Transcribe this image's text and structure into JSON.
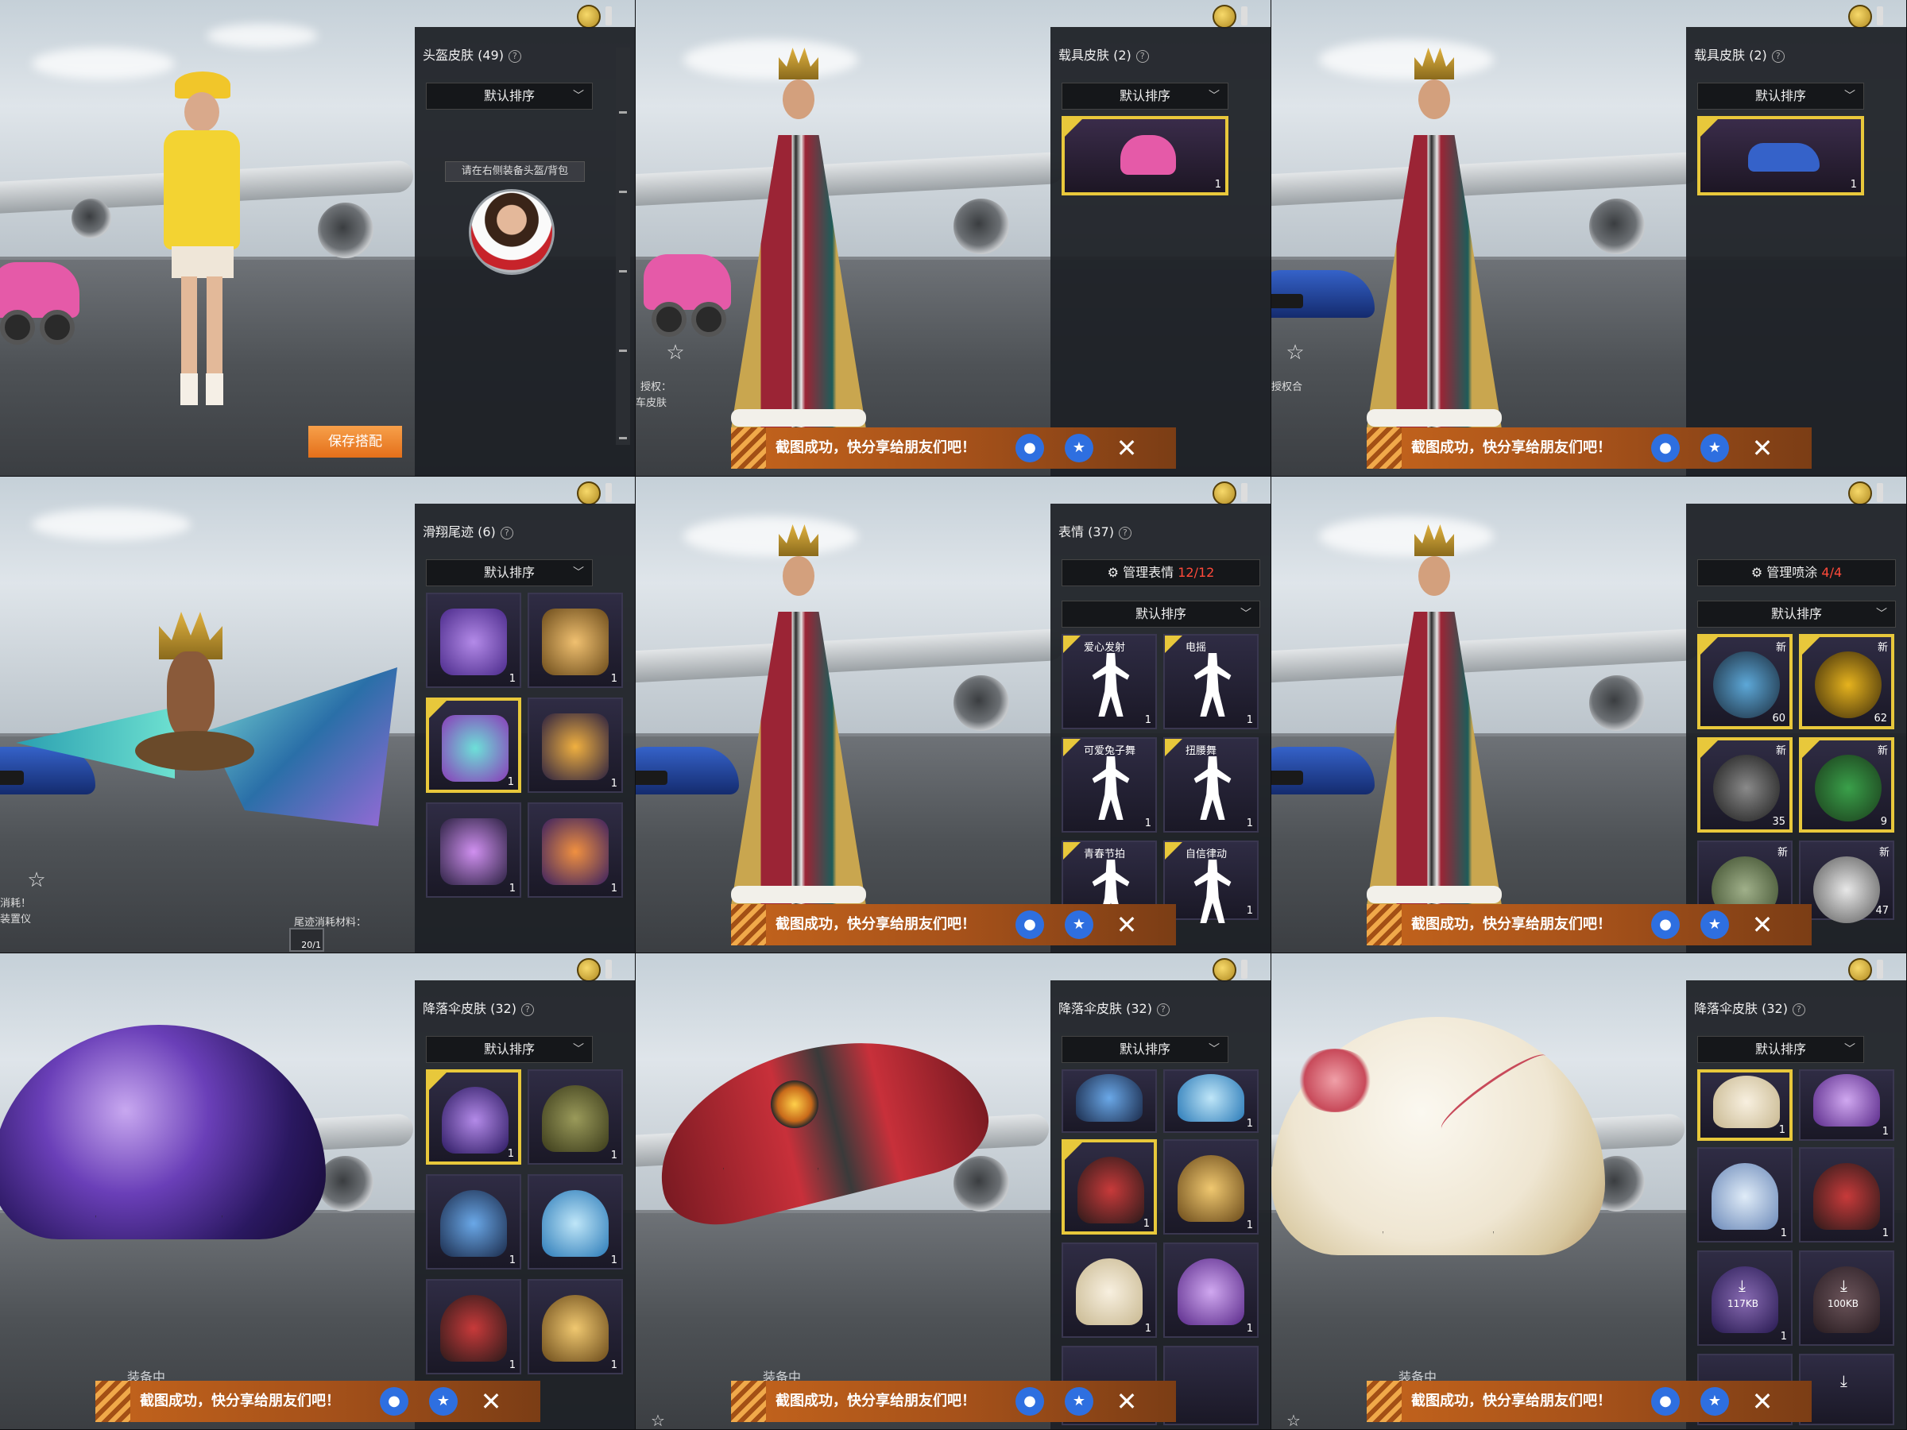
{
  "panels": [
    {
      "title": "头盔皮肤 (49)",
      "sort": "默认排序"
    },
    {
      "title": "载具皮肤 (2)",
      "sort": "默认排序"
    },
    {
      "title": "载具皮肤 (2)",
      "sort": "默认排序"
    },
    {
      "title": "滑翔尾迹 (6)",
      "sort": "默认排序"
    },
    {
      "title": "表情 (37)",
      "sort": "默认排序",
      "manage": "管理表情",
      "manage_count": "12/12"
    },
    {
      "title": "",
      "sort": "默认排序",
      "manage": "管理喷涂",
      "manage_count": "4/4"
    },
    {
      "title": "降落伞皮肤 (32)",
      "sort": "默认排序"
    },
    {
      "title": "降落伞皮肤 (32)",
      "sort": "默认排序"
    },
    {
      "title": "降落伞皮肤 (32)",
      "sort": "默认排序"
    }
  ],
  "help_icon": "question-circle-icon",
  "tooltip": "请在右侧装备头盔/背包",
  "save_button": "保存搭配",
  "share_bar": {
    "text": "截图成功，快分享给朋友们吧！",
    "qq_icon": "qq-penguin-icon",
    "qzone_icon": "qzone-star-icon",
    "close_icon": "close-x-icon"
  },
  "left_texts": {
    "license_1": "授权：",
    "license_2": "车皮肤",
    "license_3": "授权合",
    "trail_side_1": "消耗！",
    "trail_side_2": "装置仪",
    "trail_material": "尾迹消耗材料：",
    "trail_material_count": "20/1",
    "equipped": "装备中"
  },
  "trail_tiles": [
    {
      "count": "1",
      "selected": false,
      "color": "#7a55c9"
    },
    {
      "count": "1",
      "selected": false,
      "color": "#b07a2a"
    },
    {
      "count": "1",
      "selected": true,
      "color": "#3bb0b8"
    },
    {
      "count": "1",
      "selected": false,
      "color": "#d89a2a"
    },
    {
      "count": "1",
      "selected": false,
      "color": "#b35de0"
    },
    {
      "count": "1",
      "selected": false,
      "color": "#e06a2a"
    }
  ],
  "emote_tiles": [
    {
      "name": "爱心发射",
      "count": "1",
      "selected": true
    },
    {
      "name": "电摇",
      "count": "1",
      "selected": true
    },
    {
      "name": "可爱兔子舞",
      "count": "1",
      "selected": true
    },
    {
      "name": "扭腰舞",
      "count": "1",
      "selected": true
    },
    {
      "name": "青春节拍",
      "count": "1",
      "selected": true
    },
    {
      "name": "自信律动",
      "count": "1",
      "selected": true
    }
  ],
  "spray_tiles": [
    {
      "count": "60",
      "new": "新",
      "selected": true,
      "color": "#5da8d8"
    },
    {
      "count": "62",
      "new": "新",
      "selected": true,
      "color": "#e6b31e"
    },
    {
      "count": "35",
      "new": "新",
      "selected": true,
      "color": "#3b3b3b"
    },
    {
      "count": "9",
      "new": "新",
      "selected": true,
      "color": "#2d8a3c"
    },
    {
      "count": "",
      "new": "新",
      "selected": false,
      "color": "#7a8a6a"
    },
    {
      "count": "47",
      "new": "新",
      "selected": false,
      "color": "#d8d8d8"
    }
  ],
  "chute_tiles_a": [
    {
      "count": "1",
      "selected": true,
      "color": "#6a3fb8"
    },
    {
      "count": "1",
      "selected": false,
      "color": "#6b6a3a"
    },
    {
      "count": "1",
      "selected": false,
      "color": "#3a7ab8"
    },
    {
      "count": "1",
      "selected": false,
      "color": "#3aa0d8"
    },
    {
      "count": "1",
      "selected": false,
      "color": "#8a2a2a"
    },
    {
      "count": "1",
      "selected": false,
      "color": "#c89a3a"
    }
  ],
  "chute_tiles_b": [
    {
      "count": "",
      "selected": false,
      "color": "#3a7ab8"
    },
    {
      "count": "1",
      "selected": false,
      "color": "#3aa0d8"
    },
    {
      "count": "1",
      "selected": true,
      "color": "#8a2a2a"
    },
    {
      "count": "1",
      "selected": false,
      "color": "#c89a3a"
    },
    {
      "count": "1",
      "selected": false,
      "color": "#e6dcc8"
    },
    {
      "count": "1",
      "selected": false,
      "color": "#8a5ac8"
    }
  ],
  "chute_tiles_c": [
    {
      "count": "1",
      "selected": true,
      "color": "#e6dcc8",
      "size": ""
    },
    {
      "count": "1",
      "selected": false,
      "color": "#8a5ac8",
      "size": ""
    },
    {
      "count": "1",
      "selected": false,
      "color": "#9ab8e0",
      "size": ""
    },
    {
      "count": "1",
      "selected": false,
      "color": "#8a2a2a",
      "size": ""
    },
    {
      "count": "1",
      "selected": false,
      "color": "#6a3fb8",
      "size": "117KB"
    },
    {
      "count": "",
      "selected": false,
      "color": "#4a3a3a",
      "size": "100KB"
    }
  ],
  "vehicle_tile_count": "1",
  "colors": {
    "panel_bg": "#1e2126",
    "selected_border": "#e8c83b",
    "share_orange": "#c4641c",
    "manage_count": "#ff4a3a"
  }
}
